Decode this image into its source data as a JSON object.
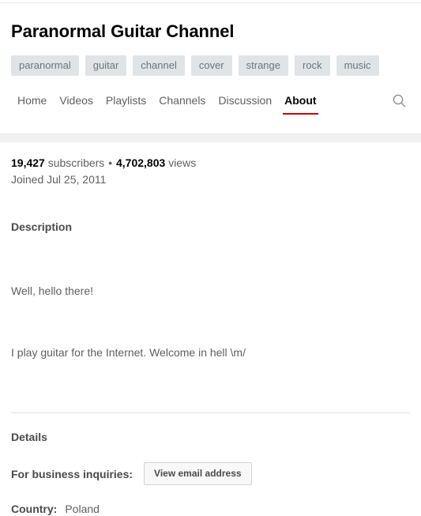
{
  "channel": {
    "title": "Paranormal Guitar Channel",
    "tags": [
      "paranormal",
      "guitar",
      "channel",
      "cover",
      "strange",
      "rock",
      "music"
    ]
  },
  "nav": {
    "tabs": [
      {
        "label": "Home",
        "active": false
      },
      {
        "label": "Videos",
        "active": false
      },
      {
        "label": "Playlists",
        "active": false
      },
      {
        "label": "Channels",
        "active": false
      },
      {
        "label": "Discussion",
        "active": false
      },
      {
        "label": "About",
        "active": true
      }
    ],
    "search_icon": "search-icon",
    "active_underline_color": "#cc0000"
  },
  "stats": {
    "subscriber_count": "19,427",
    "subscriber_label": "subscribers",
    "separator": "•",
    "view_count": "4,702,803",
    "view_label": "views",
    "joined": "Joined Jul 25, 2011"
  },
  "description": {
    "heading": "Description",
    "paragraph_1": "Well, hello there!",
    "paragraph_2": "I play guitar for the Internet. Welcome in hell \\m/"
  },
  "details": {
    "heading": "Details",
    "business_label": "For business inquiries:",
    "email_button": "View email address",
    "country_label": "Country:",
    "country_value": "Poland"
  },
  "colors": {
    "accent_red": "#cc0000",
    "tag_background": "#e1e4e6",
    "tag_text": "#727476",
    "body_text": "#606060",
    "strong_text": "#030303"
  }
}
